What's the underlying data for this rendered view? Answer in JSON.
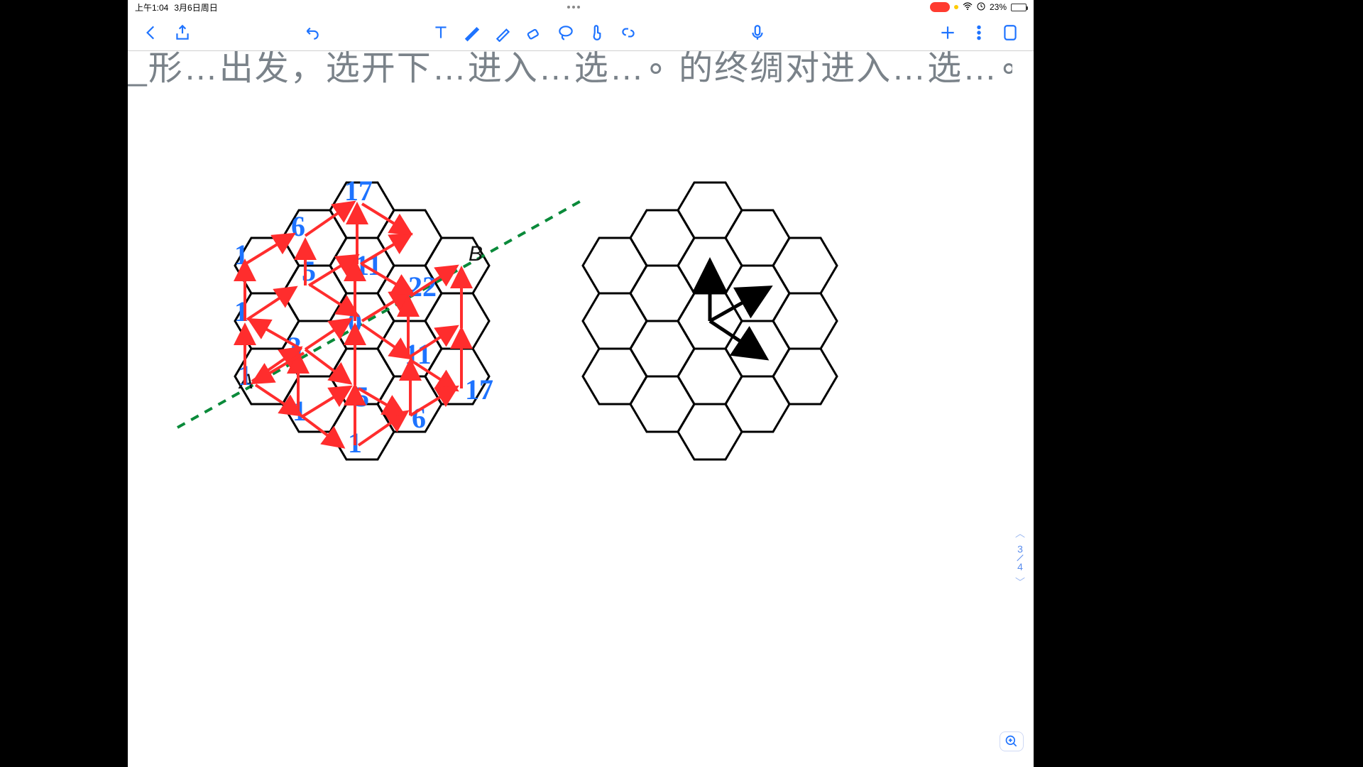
{
  "status": {
    "time": "上午1:04",
    "date": "3月6日周日",
    "battery_pct": "23%"
  },
  "page_nav": {
    "current": "3",
    "total": "4"
  },
  "partial_line": "_形…出发，选开下…进入…选…∘ 的终绸对进入…选…∘ ，",
  "label_A": "A",
  "label_B": "B",
  "hand_numbers": {
    "top_center_17": "17",
    "upper_6": "6",
    "left_upper_1": "1",
    "mid_5": "5",
    "center_11": "11",
    "right_22": "22",
    "left_mid_1": "1",
    "center_0": "0",
    "lower_3": "3",
    "far_left_1": "1",
    "lower_11": "11",
    "btm_left_1": "1",
    "btm_5": "5",
    "btm_17": "17",
    "btm_6": "6",
    "btm_center_1": "1"
  }
}
